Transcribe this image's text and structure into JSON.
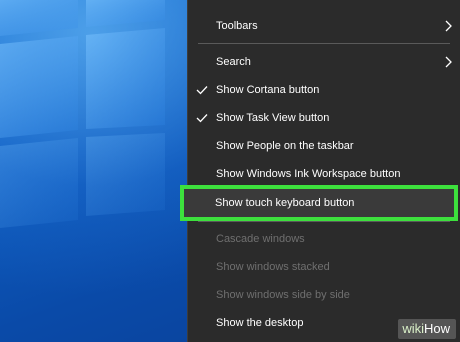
{
  "menu": {
    "items": [
      {
        "label": "Toolbars",
        "checked": false,
        "submenu": true,
        "disabled": false
      },
      {
        "label": "Search",
        "checked": false,
        "submenu": true,
        "disabled": false
      },
      {
        "label": "Show Cortana button",
        "checked": true,
        "submenu": false,
        "disabled": false
      },
      {
        "label": "Show Task View button",
        "checked": true,
        "submenu": false,
        "disabled": false
      },
      {
        "label": "Show People on the taskbar",
        "checked": false,
        "submenu": false,
        "disabled": false
      },
      {
        "label": "Show Windows Ink Workspace button",
        "checked": false,
        "submenu": false,
        "disabled": false
      },
      {
        "label": "Show touch keyboard button",
        "checked": false,
        "submenu": false,
        "disabled": false,
        "highlighted": true
      },
      {
        "label": "Cascade windows",
        "checked": false,
        "submenu": false,
        "disabled": true
      },
      {
        "label": "Show windows stacked",
        "checked": false,
        "submenu": false,
        "disabled": true
      },
      {
        "label": "Show windows side by side",
        "checked": false,
        "submenu": false,
        "disabled": true
      },
      {
        "label": "Show the desktop",
        "checked": false,
        "submenu": false,
        "disabled": false
      }
    ]
  },
  "highlight_color": "#3de03d",
  "watermark": {
    "wiki": "wiki",
    "how": "How"
  }
}
